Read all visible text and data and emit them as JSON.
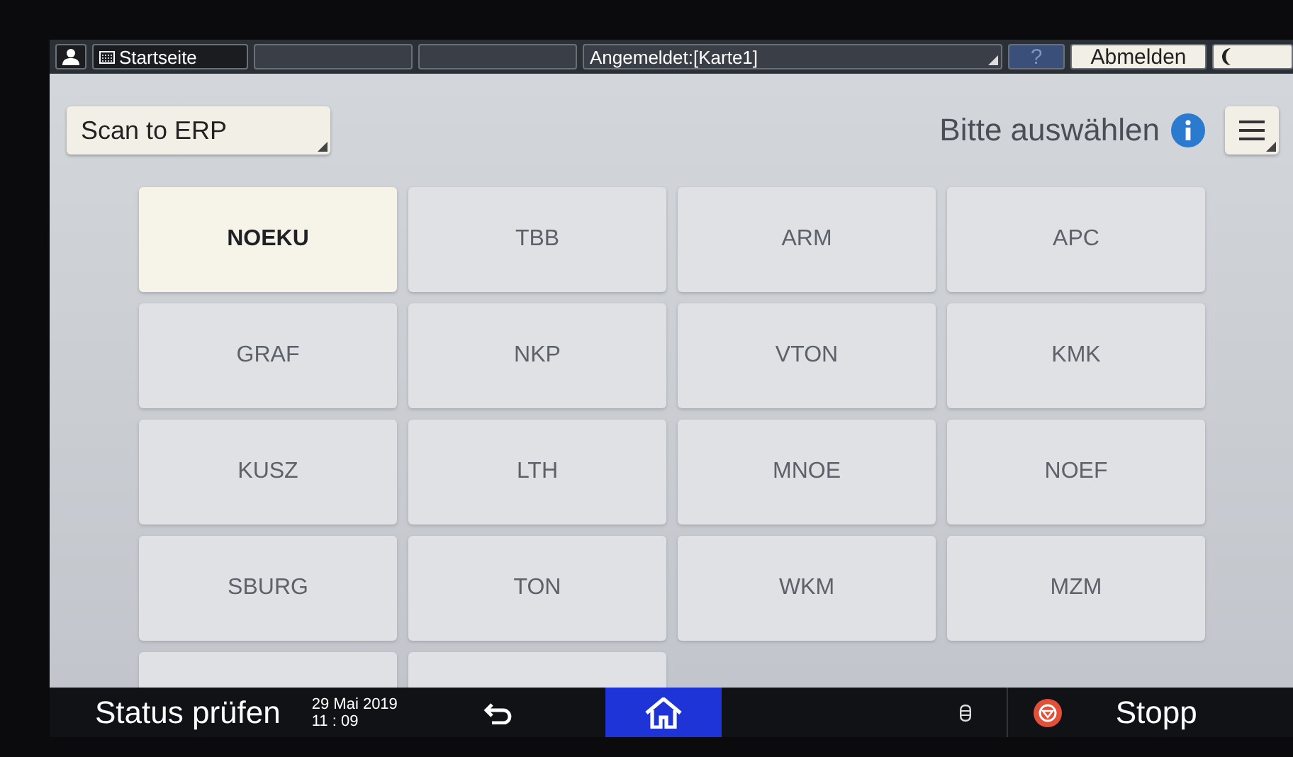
{
  "top_bar": {
    "home_label": "Startseite",
    "login_status": "Angemeldet:[Karte1]",
    "help": "?",
    "logout": "Abmelden"
  },
  "header": {
    "dropdown": "Scan to ERP",
    "prompt": "Bitte auswählen"
  },
  "tiles": [
    {
      "label": "NOEKU",
      "selected": true
    },
    {
      "label": "TBB",
      "selected": false
    },
    {
      "label": "ARM",
      "selected": false
    },
    {
      "label": "APC",
      "selected": false
    },
    {
      "label": "GRAF",
      "selected": false
    },
    {
      "label": "NKP",
      "selected": false
    },
    {
      "label": "VTON",
      "selected": false
    },
    {
      "label": "KMK",
      "selected": false
    },
    {
      "label": "KUSZ",
      "selected": false
    },
    {
      "label": "LTH",
      "selected": false
    },
    {
      "label": "MNOE",
      "selected": false
    },
    {
      "label": "NOEF",
      "selected": false
    },
    {
      "label": "SBURG",
      "selected": false
    },
    {
      "label": "TON",
      "selected": false
    },
    {
      "label": "WKM",
      "selected": false
    },
    {
      "label": "MZM",
      "selected": false
    }
  ],
  "bottom_bar": {
    "status": "Status prüfen",
    "date": "29 Mai 2019",
    "time": "11 : 09",
    "stop": "Stopp"
  }
}
